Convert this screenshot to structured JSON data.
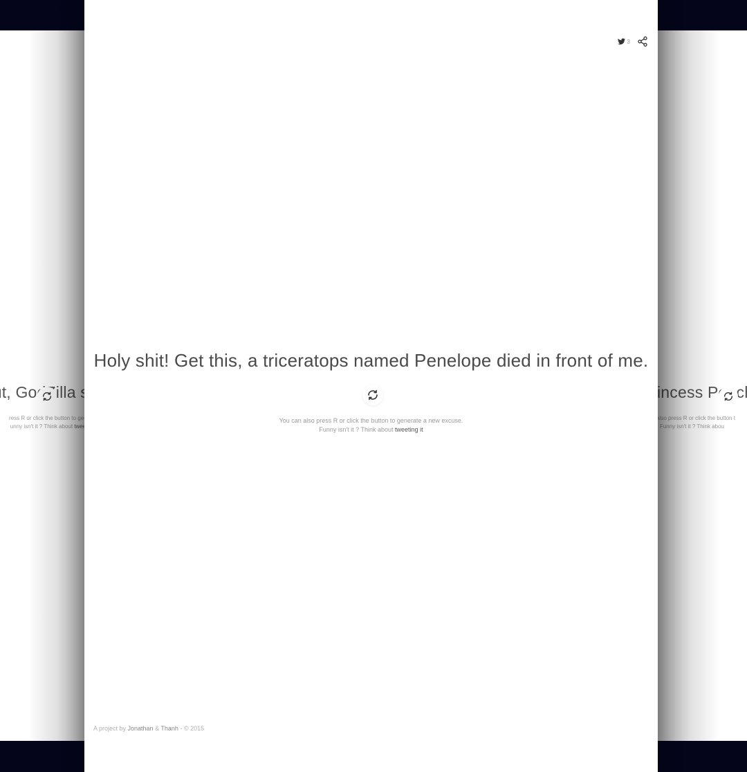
{
  "left_card": {
    "excuse": "ut, GodZilla s",
    "hint_line1": "ress R or click the button to gene",
    "hint_line2_prefix": "unny isn't it ? Think about ",
    "hint_link": "tweeti"
  },
  "right_card": {
    "excuse": "incess Peach",
    "hint_line1": "an also press R or click the button t",
    "hint_line2_prefix": "Funny isn't it ? Think abou"
  },
  "main": {
    "tweet_count": "3",
    "excuse": "Holy shit! Get this, a triceratops named Penelope died in front of me.",
    "hint_line1": "You can also press R or click the button to generate a new excuse.",
    "hint_line2_prefix": "Funny isn't it ? Think about ",
    "hint_link": "tweeting it"
  },
  "footer": {
    "prefix": "A project by ",
    "author1": "Jonathan",
    "amp": " & ",
    "author2": "Thanh",
    "suffix": " - © 2015"
  },
  "icons": {
    "twitter": "twitter-icon",
    "share": "share-icon",
    "refresh": "refresh-icon"
  },
  "colors": {
    "background": "#04051a",
    "card": "#ffffff",
    "text": "#4a4a4a",
    "muted": "#9a9a9a"
  }
}
